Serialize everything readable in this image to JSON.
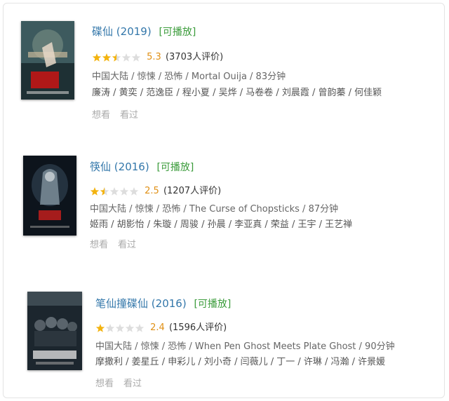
{
  "results": [
    {
      "title": "碟仙",
      "year": "(2019)",
      "playable": "[可播放]",
      "rating": 5.3,
      "score_text": "5.3",
      "votes_text": "(3703人评价)",
      "meta": "中国大陆 / 惊悚 / 恐怖 / Mortal Ouija / 83分钟",
      "cast": "廉涛 / 黄奕 / 范逸臣 / 程小夏 / 吴烨 / 马卷卷 / 刘晨霞 / 曾韵蓁 / 何佳颖",
      "want": "想看",
      "seen": "看过",
      "poster_theme": "#203a40"
    },
    {
      "title": "筷仙",
      "year": "(2016)",
      "playable": "[可播放]",
      "rating": 2.5,
      "score_text": "2.5",
      "votes_text": "(1207人评价)",
      "meta": "中国大陆 / 惊悚 / 恐怖 / The Curse of Chopsticks / 87分钟",
      "cast": "姬雨 / 胡影怡 / 朱璇 / 周骏 / 孙晨 / 李亚真 / 荣益 / 王宇 / 王艺禅",
      "want": "想看",
      "seen": "看过",
      "poster_theme": "#101822"
    },
    {
      "title": "笔仙撞碟仙",
      "year": "(2016)",
      "playable": "[可播放]",
      "rating": 2.4,
      "score_text": "2.4",
      "votes_text": "(1596人评价)",
      "meta": "中国大陆 / 惊悚 / 恐怖 / When Pen Ghost Meets Plate Ghost / 90分钟",
      "cast": "摩撒利 / 姜星丘 / 申彩儿 / 刘小奇 / 闫薇儿 / 丁一 / 许琳 / 冯瀚 / 许景媛",
      "want": "想看",
      "seen": "看过",
      "poster_theme": "#26323a"
    }
  ],
  "colors": {
    "title": "#3377aa",
    "playable": "#3a9b3a",
    "score": "#e09015",
    "star_on": "#f3b30f",
    "star_off": "#dddddd"
  }
}
